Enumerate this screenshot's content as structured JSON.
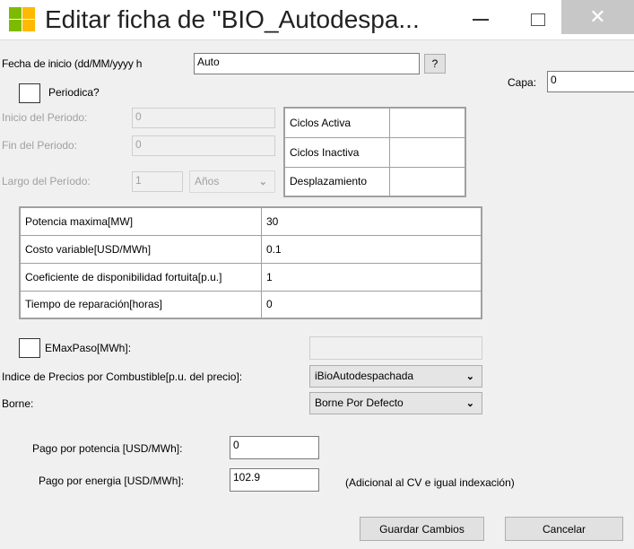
{
  "window": {
    "title": "Editar ficha de  \"BIO_Autodespa...",
    "minimize": "–",
    "maximize": "☐",
    "close": "✕"
  },
  "fecha": {
    "label": "Fecha de inicio (dd/MM/yyyy h",
    "value": "Auto",
    "help_button": "?"
  },
  "capa": {
    "label": "Capa:",
    "value": "0"
  },
  "periodica": {
    "label": "Periodica?",
    "checked": false
  },
  "periodo": {
    "inicio_label": "Inicio del Periodo:",
    "inicio_value": "0",
    "fin_label": "Fin del Periodo:",
    "fin_value": "0",
    "largo_label": "Largo del Período:",
    "largo_value": "1",
    "unit": "Años"
  },
  "ciclos": [
    {
      "label": "Ciclos Activa",
      "value": ""
    },
    {
      "label": "Ciclos Inactiva",
      "value": ""
    },
    {
      "label": "Desplazamiento",
      "value": ""
    }
  ],
  "params": [
    {
      "label": "Potencia maxima[MW]",
      "value": "30"
    },
    {
      "label": "Costo variable[USD/MWh]",
      "value": "0.1"
    },
    {
      "label": "Coeficiente de disponibilidad fortuita[p.u.]",
      "value": "1"
    },
    {
      "label": "Tiempo de reparación[horas]",
      "value": "0"
    }
  ],
  "emax": {
    "label": "EMaxPaso[MWh]:",
    "checked": false,
    "value": ""
  },
  "indice": {
    "label": "Indice de Precios por Combustible[p.u. del precio]:",
    "value": "iBioAutodespachada"
  },
  "borne": {
    "label": "Borne:",
    "value": "Borne Por Defecto"
  },
  "pago_potencia": {
    "label": "Pago por potencia [USD/MWh]:",
    "value": "0"
  },
  "pago_energia": {
    "label": "Pago por energia  [USD/MWh]:",
    "value": "102.9",
    "note": "(Adicional al CV e igual indexación)"
  },
  "buttons": {
    "save": "Guardar Cambios",
    "cancel": "Cancelar"
  },
  "colors": {
    "icon_green": "#7cbb00",
    "icon_yellow": "#ffb900",
    "close_bg": "#c7c7c7"
  }
}
